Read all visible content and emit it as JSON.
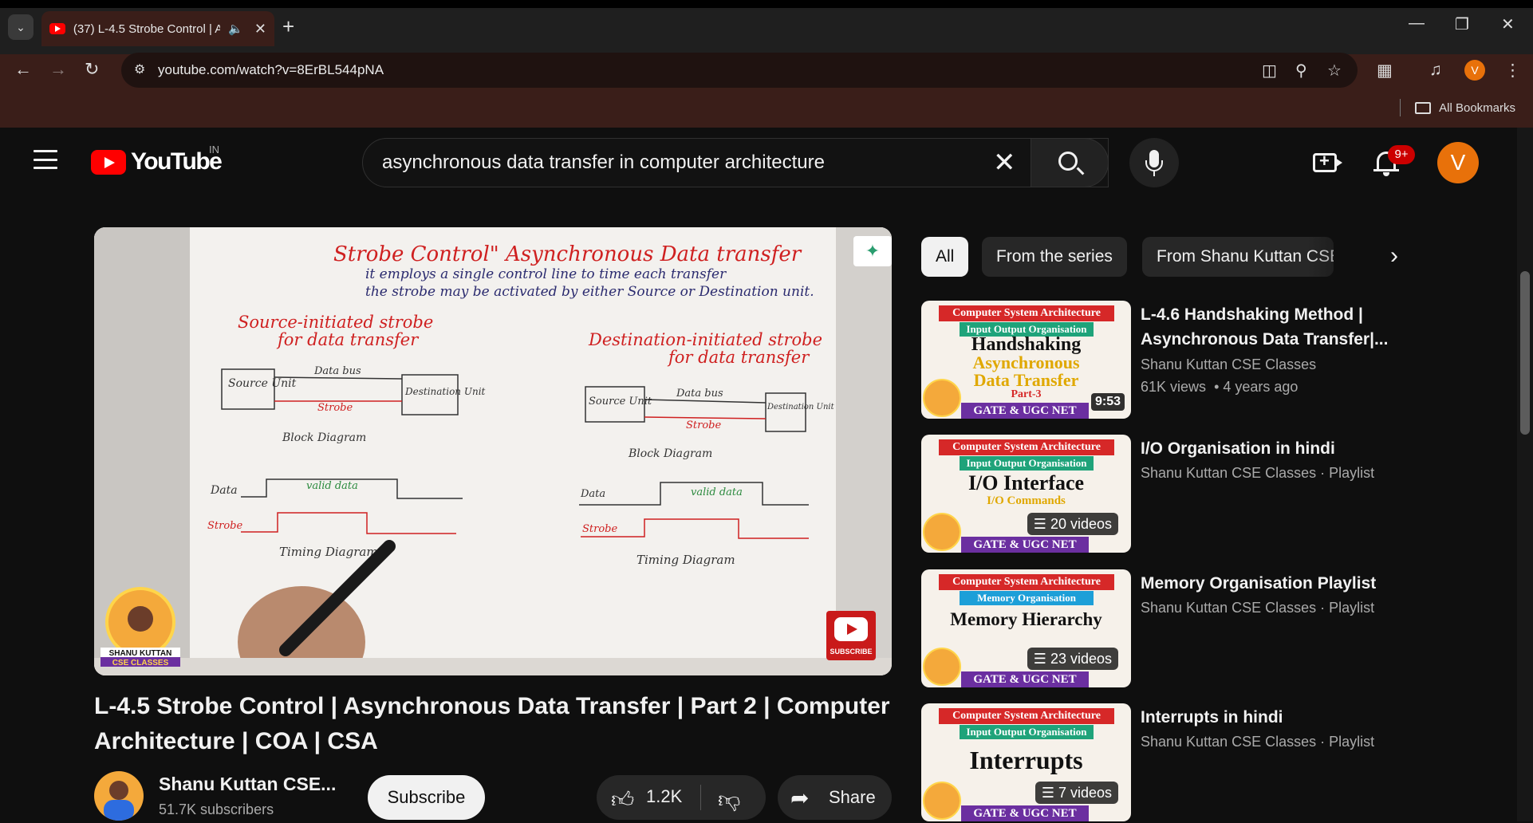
{
  "browser": {
    "tab_title": "(37) L-4.5 Strobe Control | A",
    "url": "youtube.com/watch?v=8ErBL544pNA",
    "profile_initial": "V",
    "bookmarks_label": "All Bookmarks"
  },
  "youtube": {
    "logo_text": "YouTube",
    "country_code": "IN",
    "search_query": "asynchronous data transfer in computer architecture",
    "notif_count": "9+",
    "avatar_initial": "V"
  },
  "video": {
    "title": "L-4.5 Strobe Control | Asynchronous Data Transfer | Part 2 | Computer Architecture | COA | CSA",
    "channel": "Shanu Kuttan CSE...",
    "subscribers": "51.7K subscribers",
    "subscribe_label": "Subscribe",
    "likes": "1.2K",
    "share_label": "Share",
    "watermark_channel_1": "SHANU KUTTAN",
    "watermark_channel_2": "CSE CLASSES",
    "watermark_subscribe": "SUBSCRIBE",
    "board": {
      "heading": "Strobe Control\" Asynchronous Data transfer",
      "line1": "it employs a single control line to time each transfer",
      "line2": "the strobe may be activated by either Source or Destination unit.",
      "left_title1": "Source-initiated strobe",
      "left_title2": "for data transfer",
      "right_title1": "Destination-initiated strobe",
      "right_title2": "for data transfer",
      "source_unit": "Source Unit",
      "dest_unit": "Destination Unit",
      "data_bus": "Data bus",
      "strobe": "Strobe",
      "block_a": "Block Diagram",
      "timing_b": "Timing Diagram",
      "valid_data": "valid data",
      "data": "Data"
    }
  },
  "chips": [
    "All",
    "From the series",
    "From Shanu Kuttan CSE C"
  ],
  "recommendations": [
    {
      "title": "L-4.6 Handshaking Method | Asynchronous Data Transfer|...",
      "channel": "Shanu Kuttan CSE Classes",
      "views": "61K views",
      "age": "4 years ago",
      "badge": "9:53",
      "thumb_band1": "Computer System Architecture",
      "thumb_band2": "Input Output Organisation",
      "thumb_head1": "Handshaking",
      "thumb_head2": "Asynchronous",
      "thumb_head3": "Data Transfer",
      "thumb_part": "Part-3",
      "thumb_footer": "GATE & UGC NET"
    },
    {
      "title": "I/O Organisation in hindi",
      "channel": "Shanu Kuttan CSE Classes · Playlist",
      "badge": "20 videos",
      "thumb_band1": "Computer System Architecture",
      "thumb_band2": "Input Output Organisation",
      "thumb_head1": "I/O Interface",
      "thumb_head2": "I/O Commands",
      "thumb_footer": "GATE & UGC NET"
    },
    {
      "title": "Memory Organisation Playlist",
      "channel": "Shanu Kuttan CSE Classes · Playlist",
      "badge": "23 videos",
      "thumb_band1": "Computer System Architecture",
      "thumb_band2": "Memory Organisation",
      "thumb_head1": "Memory Hierarchy",
      "thumb_footer": "GATE & UGC NET"
    },
    {
      "title": "Interrupts in hindi",
      "channel": "Shanu Kuttan CSE Classes · Playlist",
      "badge": "7 videos",
      "thumb_band1": "Computer System Architecture",
      "thumb_band2": "Input Output Organisation",
      "thumb_head1": "Interrupts",
      "thumb_footer": "GATE & UGC NET"
    }
  ]
}
